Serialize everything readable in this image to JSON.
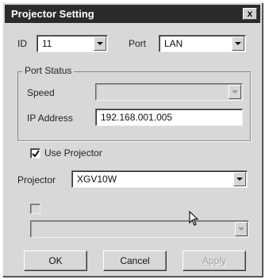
{
  "window": {
    "title": "Projector Setting",
    "close_label": "x"
  },
  "id_field": {
    "label": "ID",
    "value": "11"
  },
  "port_field": {
    "label": "Port",
    "value": "LAN"
  },
  "port_status": {
    "title": "Port Status",
    "speed_label": "Speed",
    "speed_value": "",
    "ip_label": "IP Address",
    "ip_value": "192.168.001.005"
  },
  "use_projector": {
    "label": "Use Projector",
    "checked": true
  },
  "projector_field": {
    "label": "Projector",
    "value": "XGV10W"
  },
  "second_option": {
    "label": "",
    "checked": false,
    "value": ""
  },
  "buttons": {
    "ok": "OK",
    "cancel": "Cancel",
    "apply": "Apply"
  }
}
